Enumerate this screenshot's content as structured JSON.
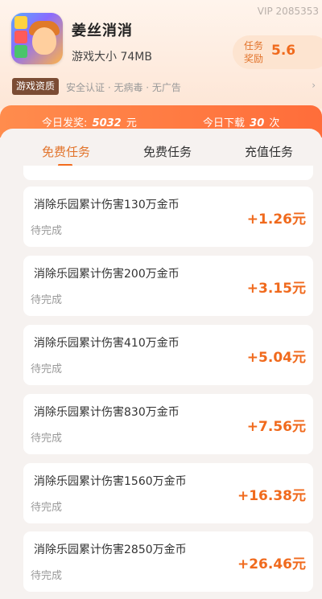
{
  "header": {
    "vip_text": "VIP 2085353",
    "game_title": "姜丝消消",
    "game_meta": "游戏大小 74MB",
    "reward_label": "任务奖励",
    "reward_value": "5.6"
  },
  "badges": {
    "qualification": "游戏资质",
    "certs": "安全认证 · 无病毒 · 无广告",
    "arrow": "›"
  },
  "stats": {
    "left_prefix": "今日发奖:",
    "left_value": "5032",
    "left_unit": "元",
    "right_prefix": "今日下载",
    "right_value": "30",
    "right_unit": "次"
  },
  "tabs": [
    {
      "label": "免费任务"
    },
    {
      "label": "免费任务"
    },
    {
      "label": "充值任务"
    }
  ],
  "tasks": [
    {
      "name": "消除乐园累计伤害130万金币",
      "status": "待完成",
      "reward": "+1.26元"
    },
    {
      "name": "消除乐园累计伤害200万金币",
      "status": "待完成",
      "reward": "+3.15元"
    },
    {
      "name": "消除乐园累计伤害410万金币",
      "status": "待完成",
      "reward": "+5.04元"
    },
    {
      "name": "消除乐园累计伤害830万金币",
      "status": "待完成",
      "reward": "+7.56元"
    },
    {
      "name": "消除乐园累计伤害1560万金币",
      "status": "待完成",
      "reward": "+16.38元"
    },
    {
      "name": "消除乐园累计伤害2850万金币",
      "status": "待完成",
      "reward": "+26.46元"
    }
  ],
  "colors": {
    "accent": "#f06a1d",
    "stats_bar": "#ff7a43",
    "badge_bg": "#7b4c34"
  }
}
